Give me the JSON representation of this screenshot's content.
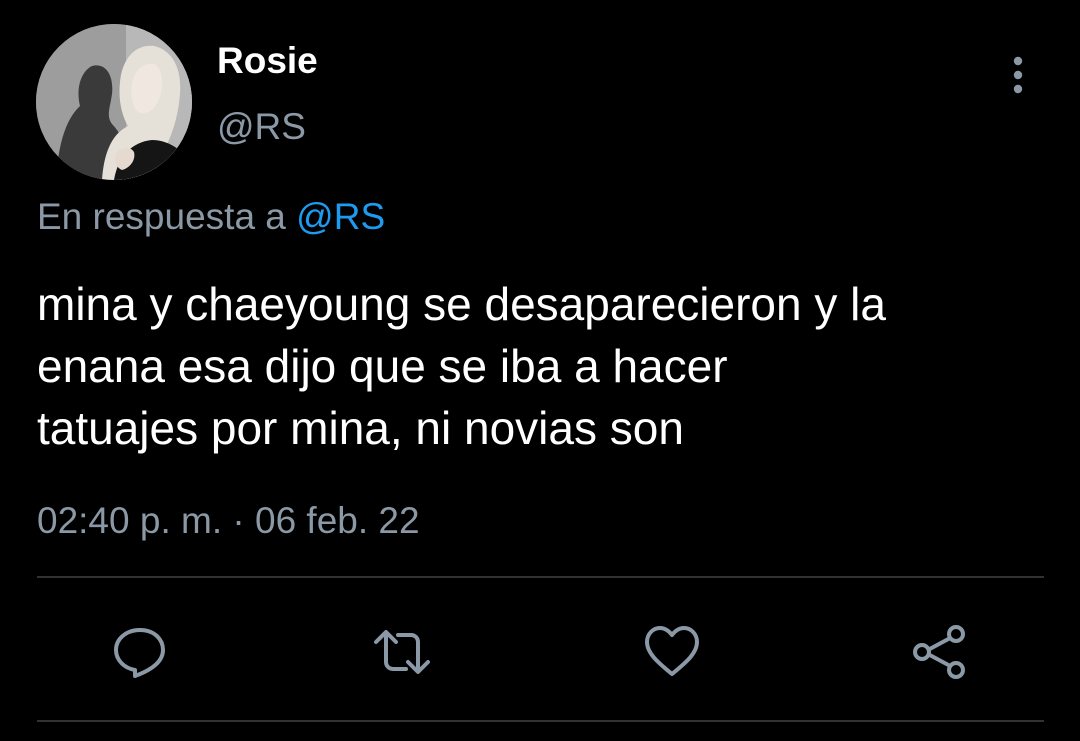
{
  "tweet": {
    "display_name": "Rosie",
    "handle": "@RS",
    "reply_prefix": "En respuesta a",
    "reply_mention": "@RS",
    "text": "mina y chaeyoung se desaparecieron y la\nenana esa dijo que se iba a hacer\ntatuajes por mina, ni novias son",
    "timestamp": "02:40 p. m. · 06 feb. 22"
  },
  "icons": {
    "more": "more-vertical-icon",
    "reply": "reply-icon",
    "retweet": "retweet-icon",
    "like": "like-icon",
    "share": "share-icon"
  },
  "colors": {
    "background": "#000000",
    "primary_text": "#ffffff",
    "secondary_text": "#8b98a5",
    "link": "#1d9bf0",
    "divider": "#2f3336"
  }
}
